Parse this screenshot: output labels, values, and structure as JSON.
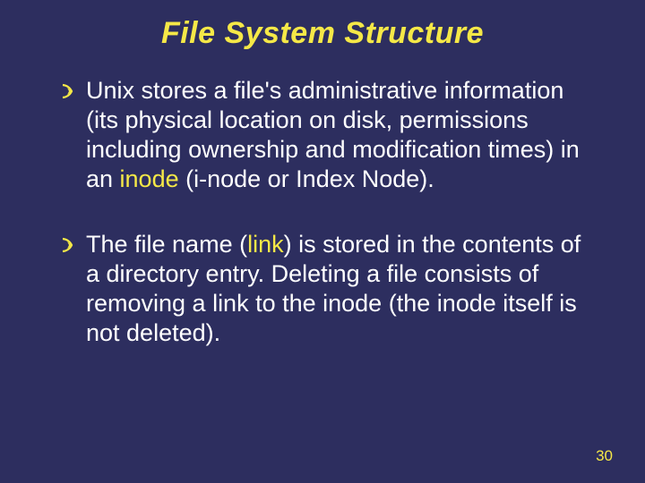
{
  "title": "File System Structure",
  "bullets": [
    {
      "pre1": "Unix stores a file's administrative information (its physical location on disk, permissions including ownership and modification times) in an ",
      "hl1": "inode",
      "post1": " (i-node or Index Node)."
    },
    {
      "pre1": "The file name (",
      "hl1": "link",
      "post1": ") is stored in the contents of a directory entry.  Deleting a file consists of removing a link to the inode (the inode itself is not deleted)."
    }
  ],
  "page_number": "30"
}
